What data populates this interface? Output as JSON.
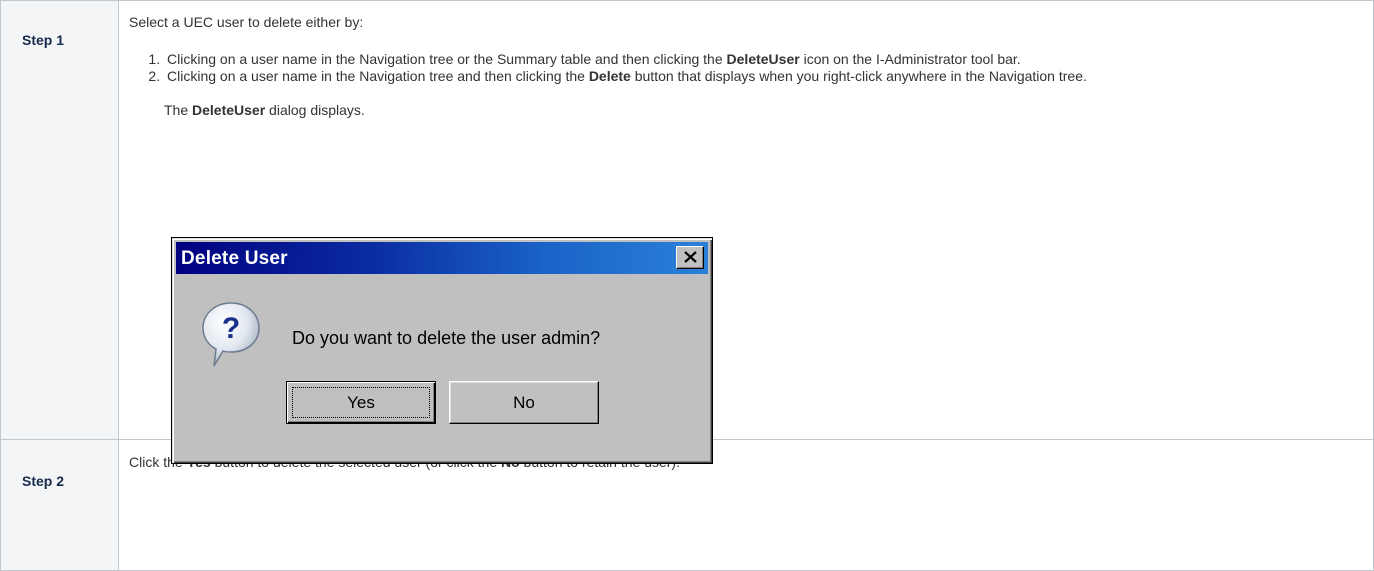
{
  "steps": [
    {
      "label": "Step 1",
      "intro": "Select a UEC user to delete either by:",
      "options": [
        {
          "before": "Clicking on a user name in the Navigation tree or the Summary table and then clicking the ",
          "bold": "DeleteUser",
          "after": " icon on the I-Administrator tool bar."
        },
        {
          "before": "Clicking on a user name in the Navigation tree and then clicking the ",
          "bold": "Delete",
          "after": " button that displays when you right-click anywhere in the Navigation tree."
        }
      ],
      "note": {
        "before": "The ",
        "bold": "DeleteUser",
        "after": " dialog displays."
      }
    },
    {
      "label": "Step 2",
      "parts": {
        "p1": "Click the ",
        "b1": "Yes",
        "p2": " button to delete the selected user (or click the ",
        "b2": "No",
        "p3": " button to retain the user)."
      }
    }
  ],
  "dialog": {
    "title": "Delete User",
    "message": "Do you want to delete the user admin?",
    "yes_label": "Yes",
    "no_label": "No",
    "icons": {
      "close": "close-icon",
      "question": "question-icon"
    }
  }
}
